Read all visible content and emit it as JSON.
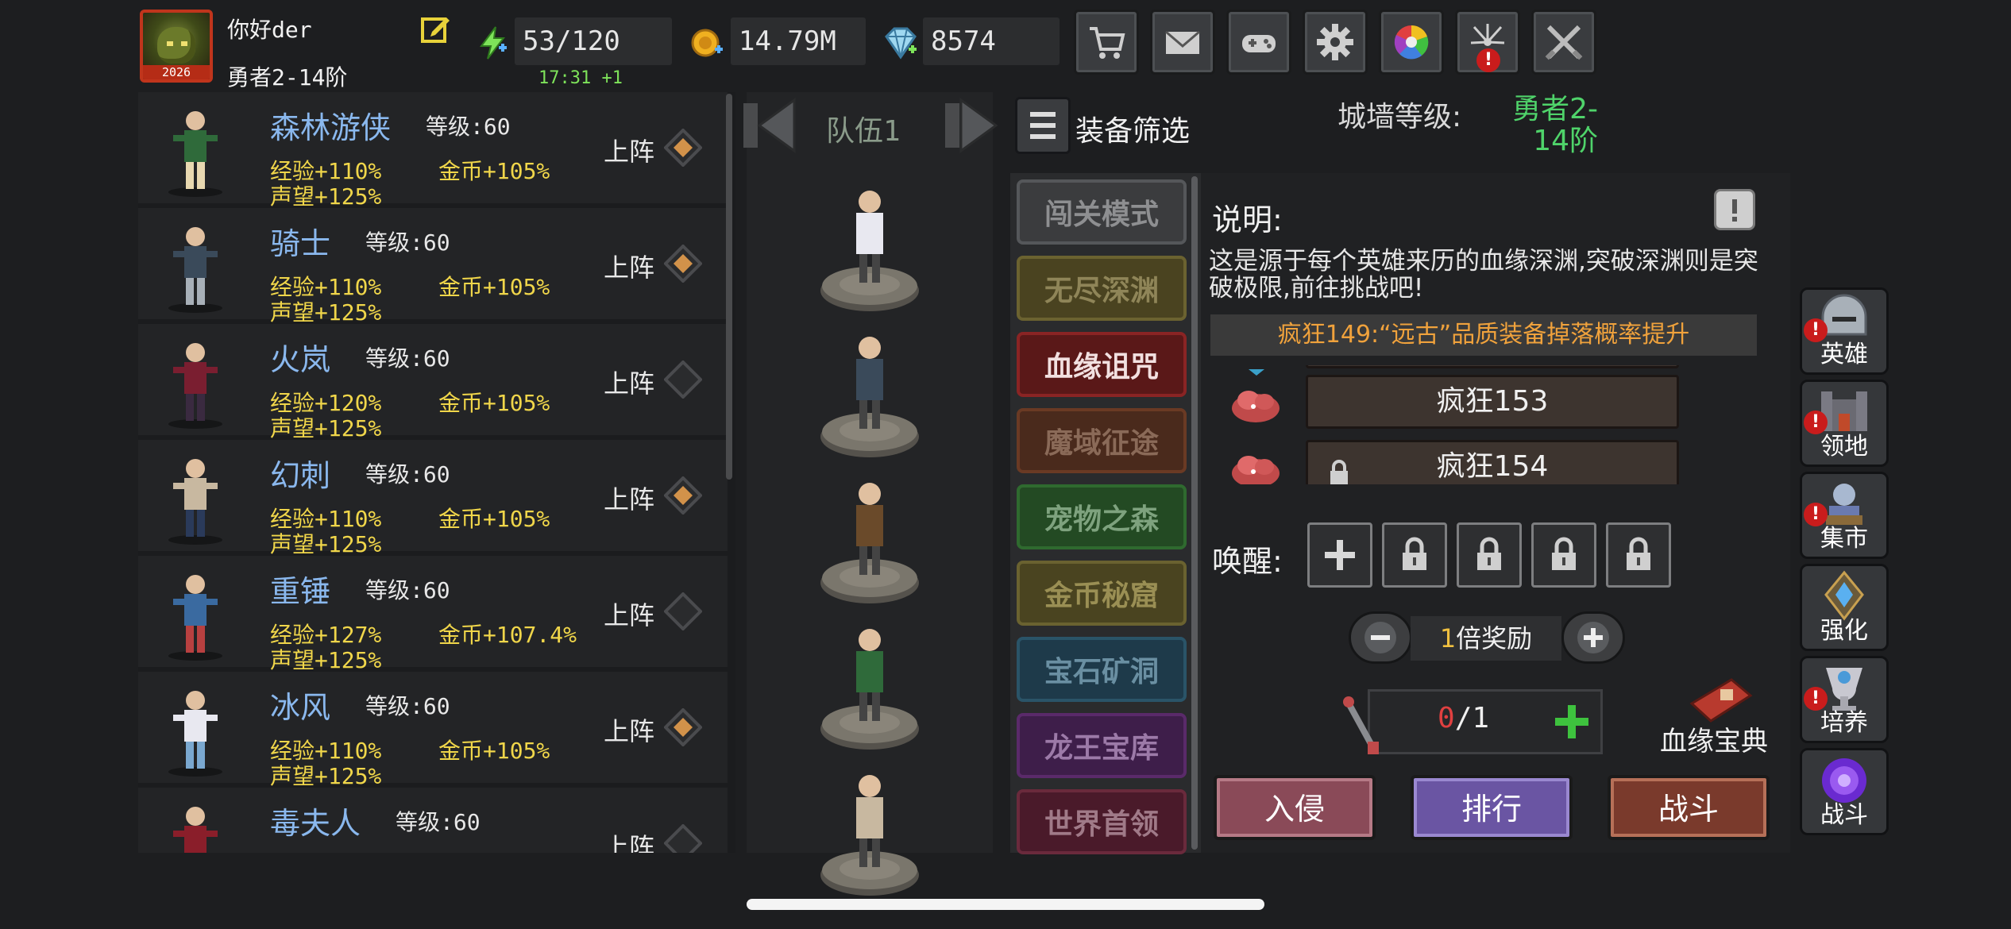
{
  "player": {
    "name": "你好der",
    "rank": "勇者2-14阶",
    "avatar_year": "2026"
  },
  "resources": {
    "energy": "53/120",
    "energy_timer": "17:31 +1",
    "coins": "14.79M",
    "gems": "8574"
  },
  "top_buttons": [
    {
      "icon": "cart-icon"
    },
    {
      "icon": "mail-icon"
    },
    {
      "icon": "gamepad-icon"
    },
    {
      "icon": "gear-icon"
    },
    {
      "icon": "color-wheel-icon"
    },
    {
      "icon": "fireworks-icon",
      "alert": "!"
    },
    {
      "icon": "crossed-swords-icon"
    }
  ],
  "heroes": [
    {
      "name": "森林游侠",
      "level": "等级:60",
      "exp": "经验+110%",
      "gold": "金币+105%",
      "rep": "声望+125%",
      "deploy": "上阵",
      "diamond": "gold"
    },
    {
      "name": "骑士",
      "level": "等级:60",
      "exp": "经验+110%",
      "gold": "金币+105%",
      "rep": "声望+125%",
      "deploy": "上阵",
      "diamond": "gold"
    },
    {
      "name": "火岚",
      "level": "等级:60",
      "exp": "经验+120%",
      "gold": "金币+105%",
      "rep": "声望+125%",
      "deploy": "上阵",
      "diamond": "empty"
    },
    {
      "name": "幻刺",
      "level": "等级:60",
      "exp": "经验+110%",
      "gold": "金币+105%",
      "rep": "声望+125%",
      "deploy": "上阵",
      "diamond": "gold"
    },
    {
      "name": "重锤",
      "level": "等级:60",
      "exp": "经验+127%",
      "gold": "金币+107.4%",
      "rep": "声望+125%",
      "deploy": "上阵",
      "diamond": "empty"
    },
    {
      "name": "冰风",
      "level": "等级:60",
      "exp": "经验+110%",
      "gold": "金币+105%",
      "rep": "声望+125%",
      "deploy": "上阵",
      "diamond": "gold"
    },
    {
      "name": "毒夫人",
      "level": "等级:60",
      "exp": "",
      "gold": "",
      "rep": "",
      "deploy": "上阵",
      "diamond": "empty"
    }
  ],
  "team": {
    "title": "队伍1"
  },
  "filter_label": "装备筛选",
  "wall": {
    "label": "城墙等级:",
    "value_line1": "勇者2-",
    "value_line2": "14阶"
  },
  "modes": [
    {
      "label": "闯关模式",
      "bg": "#3b3c3e",
      "fg": "#8e8f91",
      "border": "#55575a"
    },
    {
      "label": "无尽深渊",
      "bg": "#4a4320",
      "fg": "#8f8558",
      "border": "#6b6230"
    },
    {
      "label": "血缘诅咒",
      "bg": "#5a1818",
      "fg": "#f2e0e0",
      "border": "#8a2424"
    },
    {
      "label": "魔域征途",
      "bg": "#4a2a1c",
      "fg": "#8a6a58",
      "border": "#6a3a24"
    },
    {
      "label": "宠物之森",
      "bg": "#234a23",
      "fg": "#7ea27e",
      "border": "#2f6a2f"
    },
    {
      "label": "金币秘窟",
      "bg": "#4a4420",
      "fg": "#9a8f54",
      "border": "#6a6230"
    },
    {
      "label": "宝石矿洞",
      "bg": "#1e3a4a",
      "fg": "#6a8fa2",
      "border": "#2a5468"
    },
    {
      "label": "龙王宝库",
      "bg": "#3e1e4a",
      "fg": "#9c7aa8",
      "border": "#5a2a6a"
    },
    {
      "label": "世界首领",
      "bg": "#4a1a2a",
      "fg": "#a07a88",
      "border": "#6a2a3c"
    }
  ],
  "detail": {
    "title": "说明:",
    "description": "这是源于每个英雄来历的血缘深渊,突破深渊则是突破极限,前往挑战吧!",
    "bonus": "疯狂149:“远古”品质装备掉落概率提升",
    "levels": [
      "疯狂153",
      "疯狂154"
    ],
    "awaken_label": "唤醒:",
    "multiplier_num": "1",
    "multiplier_text": "倍奖励",
    "ticket_current": "0",
    "ticket_max": "/1",
    "codex_label": "血缘宝典",
    "actions": {
      "invade": "入侵",
      "rank": "排行",
      "fight": "战斗"
    }
  },
  "nav": [
    {
      "label": "英雄",
      "icon": "helmet-icon",
      "alert": "!"
    },
    {
      "label": "领地",
      "icon": "castle-icon",
      "alert": "!"
    },
    {
      "label": "集市",
      "icon": "merchant-icon",
      "alert": "!"
    },
    {
      "label": "强化",
      "icon": "crystal-icon"
    },
    {
      "label": "培养",
      "icon": "chalice-icon",
      "alert": "!"
    },
    {
      "label": "战斗",
      "icon": "portal-icon"
    }
  ],
  "colors": {
    "accent_green": "#4fd36a",
    "gold_text": "#f0d64a",
    "hero_name": "#8ab8ee",
    "alert_red": "#c91c1c"
  }
}
